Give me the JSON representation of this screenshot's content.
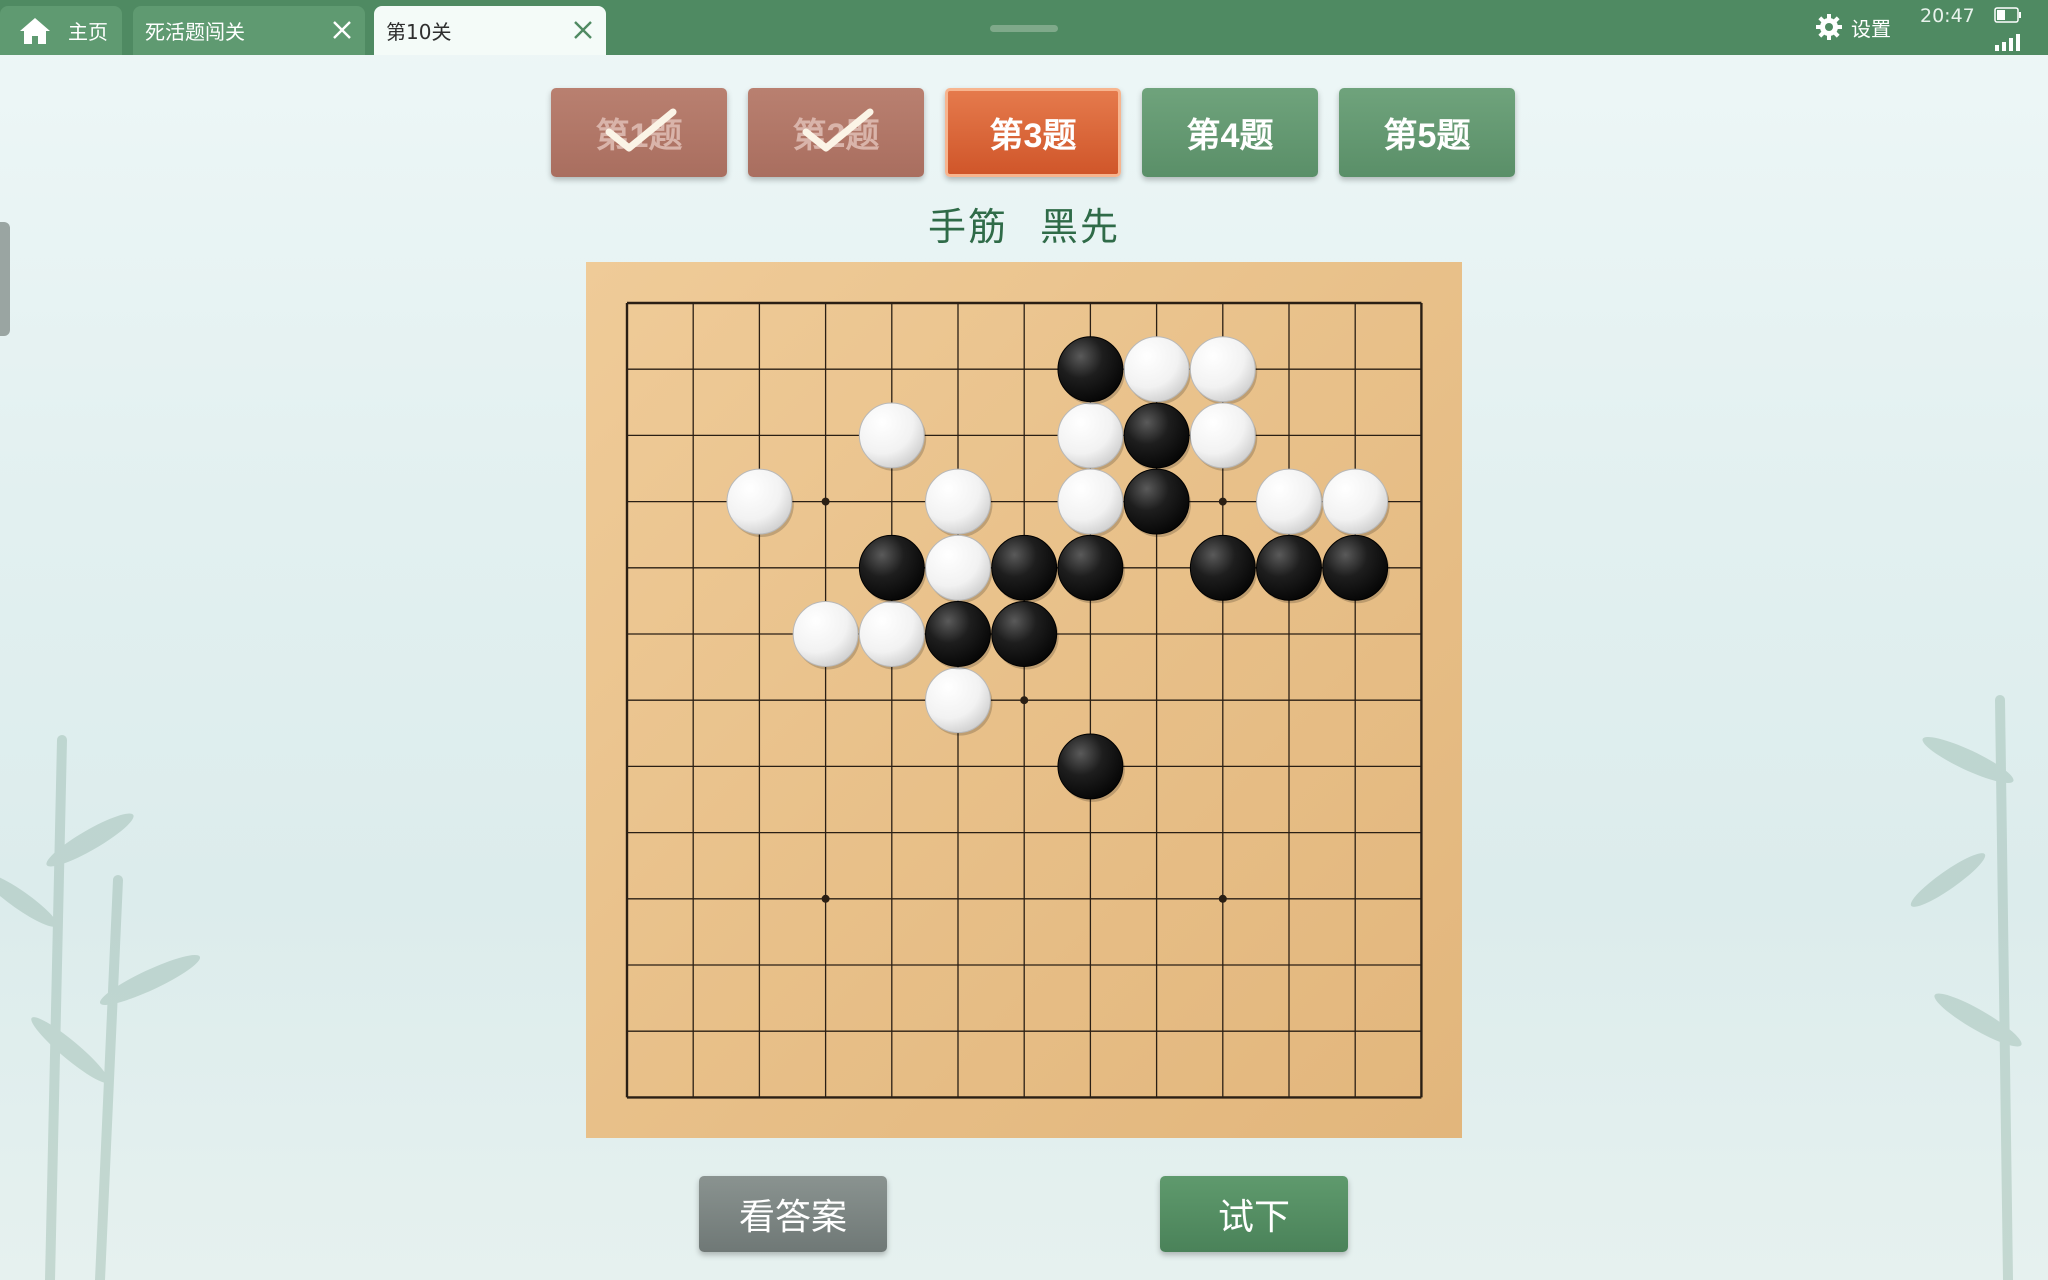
{
  "tabs": {
    "home_label": "主页",
    "tab1_label": "死活题闯关",
    "tab2_label": "第10关"
  },
  "status": {
    "settings_label": "设置",
    "time": "20:47"
  },
  "problems": [
    {
      "label": "第1题",
      "state": "done"
    },
    {
      "label": "第2题",
      "state": "done"
    },
    {
      "label": "第3题",
      "state": "current"
    },
    {
      "label": "第4题",
      "state": "todo"
    },
    {
      "label": "第5题",
      "state": "todo"
    }
  ],
  "problem_title": "手筋 黑先",
  "board": {
    "size": 13,
    "star_points": [
      [
        3,
        3
      ],
      [
        9,
        3
      ],
      [
        6,
        6
      ],
      [
        3,
        9
      ],
      [
        9,
        9
      ]
    ],
    "black": [
      [
        7,
        1
      ],
      [
        8,
        2
      ],
      [
        8,
        3
      ],
      [
        4,
        4
      ],
      [
        6,
        4
      ],
      [
        7,
        4
      ],
      [
        9,
        4
      ],
      [
        10,
        4
      ],
      [
        11,
        4
      ],
      [
        5,
        5
      ],
      [
        6,
        5
      ],
      [
        7,
        7
      ]
    ],
    "white": [
      [
        8,
        1
      ],
      [
        9,
        1
      ],
      [
        7,
        2
      ],
      [
        9,
        2
      ],
      [
        4,
        2
      ],
      [
        7,
        3
      ],
      [
        10,
        3
      ],
      [
        11,
        3
      ],
      [
        2,
        3
      ],
      [
        5,
        3
      ],
      [
        5,
        4
      ],
      [
        3,
        5
      ],
      [
        4,
        5
      ],
      [
        5,
        6
      ]
    ]
  },
  "buttons": {
    "answer_label": "看答案",
    "try_label": "试下"
  },
  "colors": {
    "tabbar": "#4f8a62",
    "current_problem": "#d9622f",
    "done_problem": "#ad7263",
    "todo_problem": "#5f9a6d",
    "board": "#e9c28d"
  }
}
